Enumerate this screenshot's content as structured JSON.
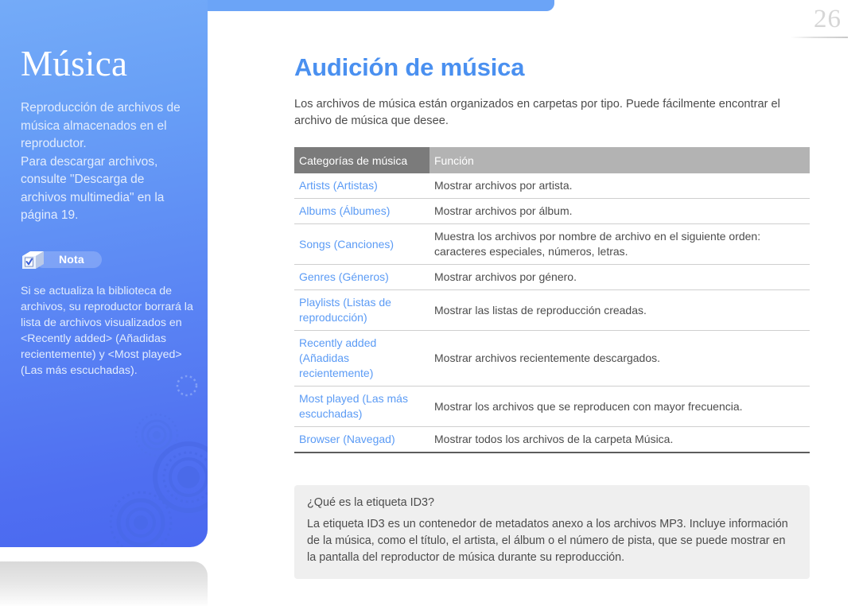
{
  "page_number": "26",
  "sidebar": {
    "title": "Música",
    "description": "Reproducción de archivos de música almacenados en el reproductor.\nPara descargar archivos, consulte \"Descarga de archivos multimedia\" en la página 19.",
    "note": {
      "icon": "note-cube-check-icon",
      "label": "Nota",
      "text": "Si se actualiza la biblioteca de archivos, su reproductor borrará la lista de archivos visualizados en <Recently added> (Añadidas recientemente) y <Most played> (Las más escuchadas)."
    },
    "colors": {
      "gradient_top": "#74abf8",
      "gradient_bottom": "#4a68f0",
      "text": "#e2ecfd"
    }
  },
  "main": {
    "section_title": "Audición de música",
    "section_title_color": "#4a90f0",
    "intro": "Los archivos de música están organizados en carpetas por tipo. Puede fácilmente encontrar el archivo de música que desee.",
    "table": {
      "headers": [
        "Categorías de música",
        "Función"
      ],
      "header_colors": [
        "#7b7b7b",
        "#b3b3b3"
      ],
      "category_color": "#5b9bf5",
      "rows": [
        {
          "category": "Artists (Artistas)",
          "function": "Mostrar archivos por artista."
        },
        {
          "category": "Albums (Álbumes)",
          "function": "Mostrar archivos por álbum."
        },
        {
          "category": "Songs (Canciones)",
          "function": "Muestra los archivos por nombre de archivo en el siguiente orden: caracteres especiales, números, letras."
        },
        {
          "category": "Genres (Géneros)",
          "function": "Mostrar archivos por género."
        },
        {
          "category": "Playlists (Listas de reproducción)",
          "function": "Mostrar las listas de reproducción creadas."
        },
        {
          "category": "Recently added (Añadidas recientemente)",
          "function": "Mostrar archivos recientemente descargados."
        },
        {
          "category": "Most played (Las más escuchadas)",
          "function": "Mostrar los archivos que se reproducen con mayor frecuencia."
        },
        {
          "category": "Browser (Navegad)",
          "function": "Mostrar todos los archivos de la carpeta Música."
        }
      ]
    },
    "id3_box": {
      "question": "¿Qué es la etiqueta ID3?",
      "body": "La etiqueta ID3 es un contenedor de metadatos anexo a los archivos MP3. Incluye información de la música, como el título, el artista, el álbum o el número de pista, que se puede mostrar en la pantalla del reproductor de música durante su reproducción.",
      "background": "#efefef"
    }
  }
}
